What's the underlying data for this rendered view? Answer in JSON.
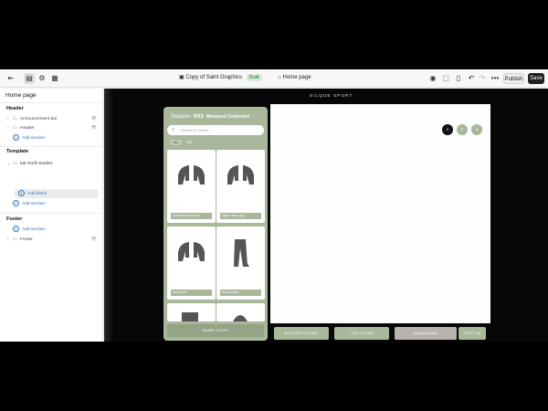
{
  "topbar": {
    "exit_icon": "exit-icon",
    "theme_title": "Copy of Saint Graphics",
    "status_badge": "Draft",
    "page_selector": "Home page",
    "publish_label": "Publish",
    "save_label": "Save",
    "more_glyph": "•••"
  },
  "sidebar": {
    "page_title": "Home page",
    "header_group": {
      "title": "Header",
      "items": [
        {
          "label": "Announcement bar"
        },
        {
          "label": "Header"
        }
      ],
      "add_section": "Add section"
    },
    "template_group": {
      "title": "Template",
      "items": [
        {
          "label": "lab Outfit Builder"
        }
      ],
      "add_block": "Add block",
      "add_section": "Add section"
    },
    "footer_group": {
      "title": "Footer",
      "add_section": "Add section",
      "items": [
        {
          "label": "Footer"
        }
      ]
    }
  },
  "preview": {
    "site_title": "SILQUE SPORT",
    "panel": {
      "season_label": "Season",
      "season_number": "003",
      "collection": "Weekend Collection",
      "search_placeholder": "SEARCH ITEMS...",
      "filters": [
        {
          "label": "ALL"
        },
        {
          "label": "W/E"
        }
      ],
      "products": [
        {
          "label": "seamless baby tee"
        },
        {
          "label": "raglan back top"
        },
        {
          "label": "turtleneck"
        },
        {
          "label": "flared pants"
        }
      ],
      "bottom_label": "SHARE OUTFIT"
    },
    "circles": [
      {
        "label": "1",
        "color": "#111111"
      },
      {
        "label": "2",
        "color": "#a9b79b"
      },
      {
        "label": "3",
        "color": "#a9b79b"
      }
    ],
    "buttons": [
      {
        "label": "ADD OUTFIT TO CART"
      },
      {
        "label": "+ ADD TO CART"
      },
      {
        "label": "your@email.com"
      },
      {
        "label": "NOTIFY ME"
      }
    ]
  },
  "colors": {
    "accent_green": "#a9b79b",
    "link_blue": "#2c6ecb",
    "save_button": "#202020"
  }
}
